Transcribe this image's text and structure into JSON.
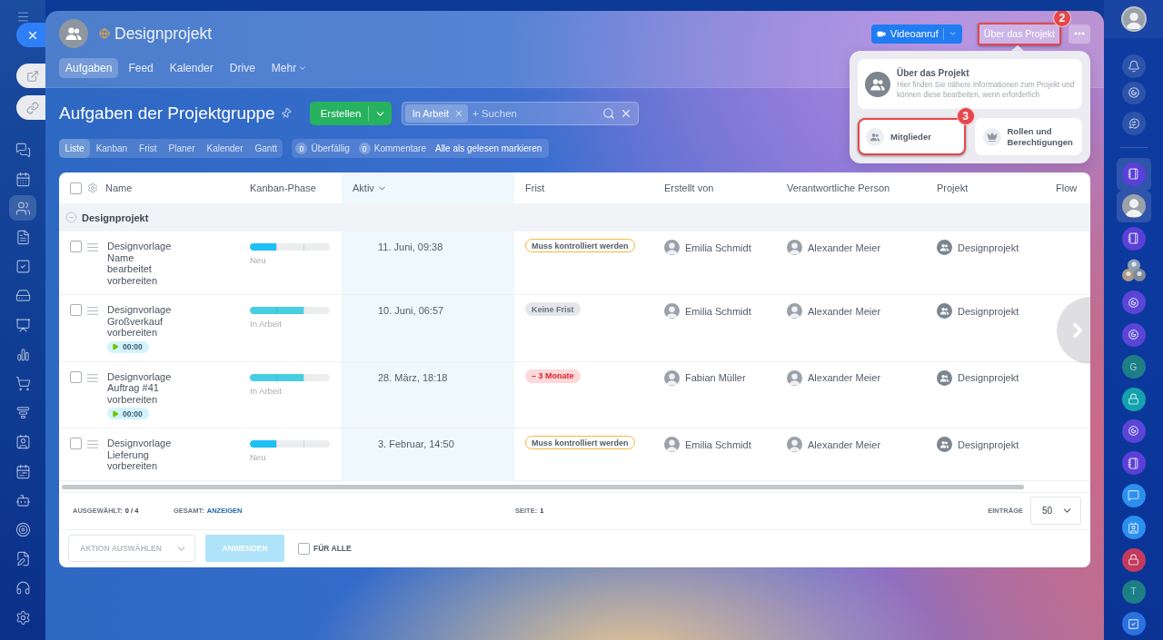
{
  "left_rail": {
    "items": [
      {
        "kind": "chat",
        "selected": false
      },
      {
        "kind": "calendar",
        "selected": false
      },
      {
        "kind": "groups",
        "selected": true
      },
      {
        "kind": "document",
        "selected": false
      },
      {
        "kind": "tasks",
        "selected": false
      },
      {
        "kind": "drive",
        "selected": false
      },
      {
        "kind": "presentation",
        "selected": false
      },
      {
        "kind": "analytics",
        "selected": false
      },
      {
        "kind": "shop",
        "selected": false
      },
      {
        "kind": "funnel",
        "selected": false
      },
      {
        "kind": "contacts",
        "selected": false
      },
      {
        "kind": "schedule",
        "selected": false
      },
      {
        "kind": "bot",
        "selected": false
      },
      {
        "kind": "target",
        "selected": false
      },
      {
        "kind": "signing",
        "selected": false
      },
      {
        "kind": "headset",
        "selected": false
      },
      {
        "kind": "settings",
        "selected": false
      }
    ]
  },
  "side_buttons": [
    {
      "kind": "close"
    },
    {
      "kind": "open"
    },
    {
      "kind": "link"
    }
  ],
  "project": {
    "title": "Designprojekt",
    "tabs": [
      {
        "label": "Aufgaben",
        "selected": true,
        "dropdown": false
      },
      {
        "label": "Feed",
        "selected": false,
        "dropdown": false
      },
      {
        "label": "Kalender",
        "selected": false,
        "dropdown": false
      },
      {
        "label": "Drive",
        "selected": false,
        "dropdown": false
      },
      {
        "label": "Mehr",
        "selected": false,
        "dropdown": true
      }
    ]
  },
  "header_actions": {
    "video_call": "Videoanruf",
    "about": {
      "label": "Über das Projekt",
      "highlighted": true,
      "callout": "2"
    }
  },
  "about_menu": {
    "title": "Über das Projekt",
    "description": "Hier finden Sie nähere Informationen zum Projekt und können diese bearbeiten, wenn erforderlich",
    "items": [
      {
        "kind": "members",
        "label": "Mitglieder",
        "highlighted": true,
        "callout": "3"
      },
      {
        "kind": "roles",
        "label": "Rollen und Berechtigungen",
        "highlighted": false
      }
    ]
  },
  "toolbar": {
    "title": "Aufgaben der Projektgruppe",
    "create": "Erstellen",
    "search": {
      "chips": [
        "In Arbeit"
      ],
      "placeholder": "+ Suchen"
    }
  },
  "views": [
    {
      "label": "Liste",
      "selected": true
    },
    {
      "label": "Kanban",
      "selected": false
    },
    {
      "label": "Frist",
      "selected": false
    },
    {
      "label": "Planer",
      "selected": false
    },
    {
      "label": "Kalender",
      "selected": false
    },
    {
      "label": "Gantt",
      "selected": false
    }
  ],
  "counters": [
    {
      "count": "0",
      "label": "Überfällig"
    },
    {
      "count": "0",
      "label": "Kommentare"
    }
  ],
  "mark_all_read": "Alle als gelesen markieren",
  "table": {
    "all_checked": false,
    "columns": [
      {
        "label": "Name",
        "sorted": false
      },
      {
        "label": "Kanban-Phase",
        "sorted": false
      },
      {
        "label": "Aktiv",
        "sorted": true
      },
      {
        "label": "Frist",
        "sorted": false
      },
      {
        "label": "Erstellt von",
        "sorted": false
      },
      {
        "label": "Verantwortliche Person",
        "sorted": false
      },
      {
        "label": "Projekt",
        "sorted": false
      },
      {
        "label": "Flow",
        "sorted": false
      }
    ],
    "groups": [
      {
        "title": "Designprojekt",
        "expanded": true,
        "rows": [
          {
            "checked": false,
            "name": "Designvorlage Name bearbeitet vorbereiten",
            "stage": {
              "label": "Neu",
              "level": 0.33,
              "color": "#1ec0f5"
            },
            "active": "11. Juni, 09:38",
            "deadline": {
              "kind": "review",
              "label": "Muss kontrolliert werden"
            },
            "created_by": "Emilia Schmidt",
            "responsible": "Alexander Meier",
            "project": "Designprojekt"
          },
          {
            "checked": false,
            "name": "Designvorlage Großverkauf vorbereiten",
            "timer": "00:00",
            "stage": {
              "label": "In Arbeit",
              "level": 0.67,
              "color": "#47cfe1"
            },
            "active": "10. Juni, 06:57",
            "deadline": {
              "kind": "none",
              "label": "Keine Frist"
            },
            "created_by": "Emilia Schmidt",
            "responsible": "Alexander Meier",
            "project": "Designprojekt"
          },
          {
            "checked": false,
            "name": "Designvorlage Auftrag #41 vorbereiten",
            "timer": "00:00",
            "stage": {
              "label": "In Arbeit",
              "level": 0.67,
              "color": "#47cfe1"
            },
            "active": "28. März, 18:18",
            "deadline": {
              "kind": "overdue",
              "label": "– 3 Monate"
            },
            "created_by": "Fabian Müller",
            "responsible": "Alexander Meier",
            "project": "Designprojekt"
          },
          {
            "checked": false,
            "name": "Designvorlage Lieferung vorbereiten",
            "stage": {
              "label": "Neu",
              "level": 0.33,
              "color": "#1ec0f5"
            },
            "active": "3. Februar, 14:50",
            "deadline": {
              "kind": "review",
              "label": "Muss kontrolliert werden"
            },
            "created_by": "Emilia Schmidt",
            "responsible": "Alexander Meier",
            "project": "Designprojekt"
          }
        ]
      }
    ]
  },
  "footer": {
    "selected": {
      "label": "AUSGEWÄHLT:",
      "value": "0 / 4"
    },
    "total": {
      "label": "GESAMT:",
      "link": "ANZEIGEN"
    },
    "page": {
      "label": "SEITE:",
      "value": "1"
    },
    "per_page": {
      "label": "EINTRÄGE",
      "value": "50"
    }
  },
  "actions": {
    "action_select": {
      "placeholder": "AKTION AUSWÄHLEN",
      "disabled": true
    },
    "apply": {
      "label": "ANWENDEN",
      "disabled": true
    },
    "for_all": {
      "label": "FÜR ALLE",
      "checked": false
    }
  },
  "right_rail": {
    "items": [
      {
        "kind": "bell"
      },
      {
        "kind": "swirl"
      },
      {
        "kind": "swap"
      }
    ],
    "chats": [
      {
        "kind": "notebook",
        "color": "#5a3fd8",
        "selected": true
      },
      {
        "kind": "person",
        "selected": true
      },
      {
        "kind": "notebook",
        "color": "#5a3fd8",
        "selected": false
      },
      {
        "kind": "group",
        "selected": false
      },
      {
        "kind": "swirl",
        "color": "#5a45d8",
        "selected": false
      },
      {
        "kind": "swirl",
        "color": "#5a45d8",
        "selected": false
      },
      {
        "kind": "letter",
        "letter": "G",
        "color": "#1d7f86",
        "selected": false
      },
      {
        "kind": "lock",
        "color": "#14a2ad",
        "selected": false
      },
      {
        "kind": "swirl",
        "color": "#5a45d8",
        "selected": false
      },
      {
        "kind": "notebook",
        "color": "#5a3fd8",
        "selected": false
      },
      {
        "kind": "chat",
        "color": "#2b8ff0",
        "selected": false
      },
      {
        "kind": "contact",
        "color": "#2b8ff0",
        "selected": false
      },
      {
        "kind": "lock",
        "color": "#c23a5e",
        "selected": false
      },
      {
        "kind": "letter",
        "letter": "T",
        "color": "#1d7f86",
        "selected": false
      },
      {
        "kind": "tasks",
        "color": "#2b72e0",
        "selected": false
      }
    ]
  }
}
